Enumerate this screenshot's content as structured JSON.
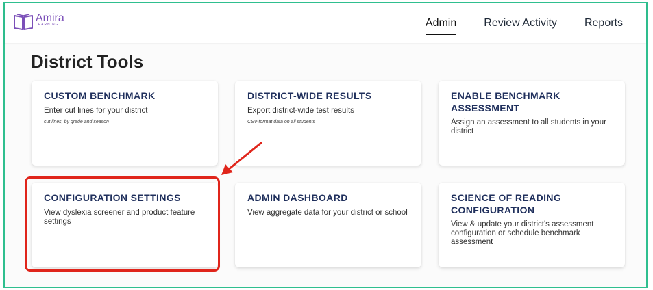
{
  "app": {
    "logo_name": "Amira",
    "logo_sub": "LEARNING"
  },
  "nav": {
    "items": [
      {
        "label": "Admin",
        "active": true
      },
      {
        "label": "Review Activity",
        "active": false
      },
      {
        "label": "Reports",
        "active": false
      }
    ]
  },
  "page": {
    "title": "District Tools"
  },
  "cards": [
    {
      "title": "CUSTOM BENCHMARK",
      "desc": "Enter cut lines for your district",
      "note": "cut lines, by grade and season"
    },
    {
      "title": "DISTRICT-WIDE RESULTS",
      "desc": "Export district-wide test results",
      "note": "CSV-format data on all students"
    },
    {
      "title": "ENABLE BENCHMARK ASSESSMENT",
      "desc": "Assign an assessment to all students in your district",
      "note": ""
    },
    {
      "title": "CONFIGURATION SETTINGS",
      "desc": "View dyslexia screener and product feature settings",
      "note": ""
    },
    {
      "title": "ADMIN DASHBOARD",
      "desc": "View aggregate data for your district or school",
      "note": ""
    },
    {
      "title": "SCIENCE OF READING CONFIGURATION",
      "desc": "View & update your district's assessment configuration or schedule benchmark assessment",
      "note": ""
    }
  ],
  "colors": {
    "accent_purple": "#7b4fb8",
    "card_title": "#1f2f5c",
    "highlight_red": "#e0251b",
    "frame_green": "#2fbf8f"
  },
  "icons": {
    "logo": "book-icon",
    "annotation": "arrow-annotation"
  }
}
